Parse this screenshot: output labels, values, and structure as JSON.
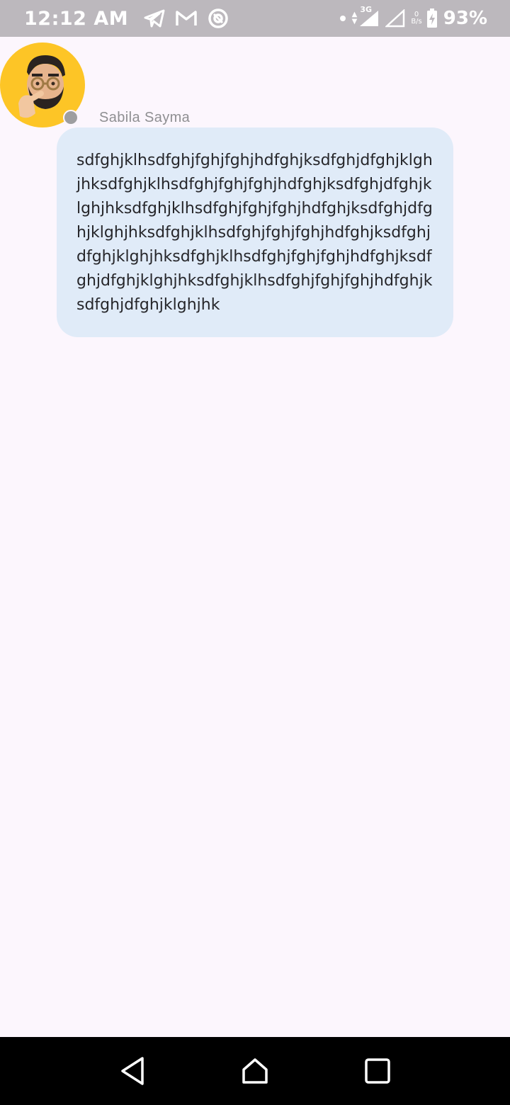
{
  "status_bar": {
    "time": "12:12 AM",
    "network_type": "3G",
    "net_speed_value": "0",
    "net_speed_unit": "B/s",
    "battery_percent": "93%",
    "left_icons": [
      "telegram-icon",
      "gmail-icon",
      "at-sign-icon"
    ],
    "right_icons": [
      "dot-icon",
      "data-arrows-icon",
      "signal-icon",
      "signal-2-icon",
      "battery-charging-icon"
    ]
  },
  "chat": {
    "sender_name": "Sabila Sayma",
    "message": "sdfghjklhsdfghjfghjfghjhdfghjksdfghjdfghjklghjhksdfghjklhsdfghjfghjfghjhdfghjksdfghjdfghjklghjhksdfghjklhsdfghjfghjfghjhdfghjksdfghjdfghjklghjhksdfghjklhsdfghjfghjfghjhdfghjksdfghjdfghjklghjhksdfghjklhsdfghjfghjfghjhdfghjksdfghjdfghjklghjhksdfghjklhsdfghjfghjfghjhdfghjksdfghjdfghjklghjhk",
    "avatar_bg": "#fdc526",
    "bubble_color": "#e0ebf8"
  },
  "nav_bar": {
    "buttons": [
      "back-icon",
      "home-icon",
      "recents-icon"
    ]
  }
}
